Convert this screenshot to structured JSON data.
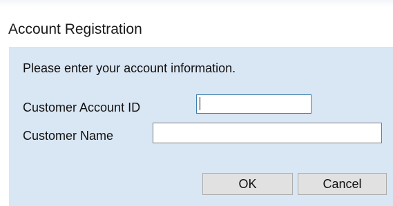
{
  "window": {
    "title": "Account Registration"
  },
  "form": {
    "prompt": "Please enter your account information.",
    "customer_account_id": {
      "label": "Customer Account ID",
      "value": ""
    },
    "customer_name": {
      "label": "Customer Name",
      "value": ""
    }
  },
  "buttons": {
    "ok_label": "OK",
    "cancel_label": "Cancel"
  },
  "colors": {
    "client_background": "#d9e6f3",
    "focused_border": "#3c7fb1",
    "button_face": "#e1e1e1"
  }
}
